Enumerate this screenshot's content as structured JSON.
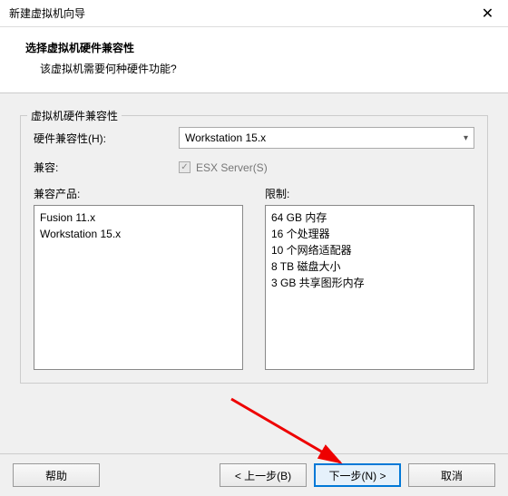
{
  "titlebar": {
    "title": "新建虚拟机向导",
    "close": "✕"
  },
  "header": {
    "title": "选择虚拟机硬件兼容性",
    "sub": "该虚拟机需要何种硬件功能?"
  },
  "group": {
    "legend": "虚拟机硬件兼容性",
    "hw_label": "硬件兼容性(H):",
    "hw_value": "Workstation 15.x",
    "compat_label": "兼容:",
    "esx_label": "ESX Server(S)",
    "products_label": "兼容产品:",
    "limits_label": "限制:",
    "products": [
      "Fusion 11.x",
      "Workstation 15.x"
    ],
    "limits": [
      "64 GB 内存",
      "16 个处理器",
      "10 个网络适配器",
      "8 TB 磁盘大小",
      "3 GB 共享图形内存"
    ]
  },
  "footer": {
    "help": "帮助",
    "back": "< 上一步(B)",
    "next": "下一步(N) >",
    "cancel": "取消"
  }
}
